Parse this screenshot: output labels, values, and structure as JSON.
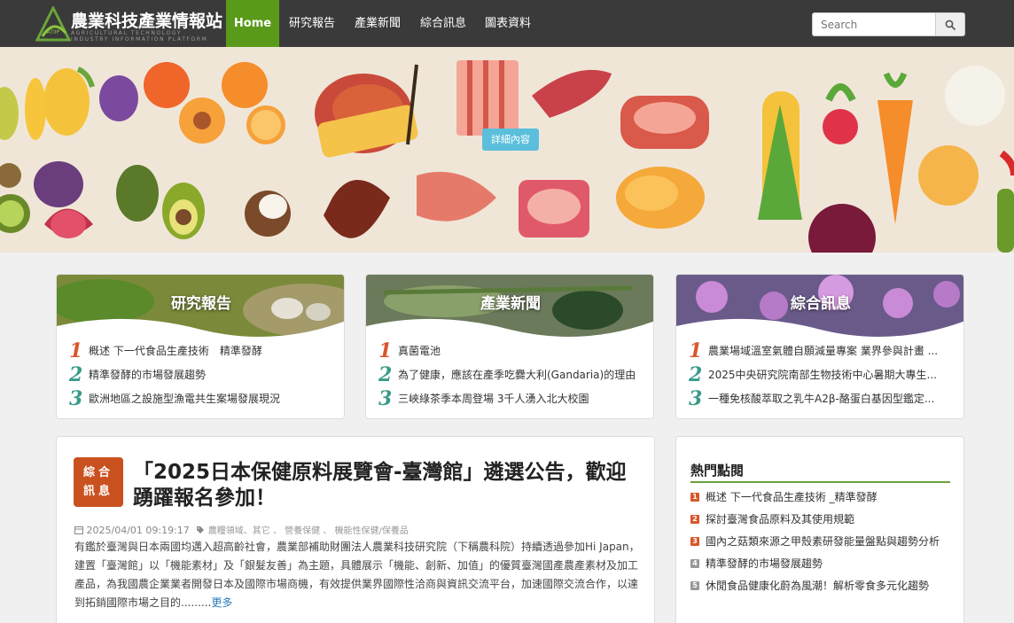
{
  "header": {
    "site_title": "農業科技產業情報站",
    "site_subtitle": "AGRICULTURAL TECHNOLOGY INDUSTRY INFORMATION PLATFORM",
    "logo_mark_text": "ATIIP",
    "nav": [
      {
        "label": "Home",
        "active": true
      },
      {
        "label": "研究報告"
      },
      {
        "label": "產業新聞"
      },
      {
        "label": "綜合訊息"
      },
      {
        "label": "圖表資料"
      }
    ],
    "search": {
      "placeholder": "Search",
      "icon": "search-icon"
    }
  },
  "banner": {
    "button_label": "詳細內容"
  },
  "cards": [
    {
      "title": "研究報告",
      "items": [
        {
          "rank": "1",
          "text": "概述 下一代食品生產技術　精準發酵"
        },
        {
          "rank": "2",
          "text": "精準發酵的市場發展趨勢"
        },
        {
          "rank": "3",
          "text": "歐洲地區之設施型漁電共生案場發展現況"
        }
      ]
    },
    {
      "title": "產業新聞",
      "items": [
        {
          "rank": "1",
          "text": "真菌電池"
        },
        {
          "rank": "2",
          "text": "為了健康，應該在產季吃爨大利(Gandaria)的理由"
        },
        {
          "rank": "3",
          "text": "三峽綠茶季本周登場 3千人湧入北大校園"
        }
      ]
    },
    {
      "title": "綜合訊息",
      "items": [
        {
          "rank": "1",
          "text": "農業場域溫室氣體自願減量專案 業界參與計畫 ..."
        },
        {
          "rank": "2",
          "text": "2025中央研究院南部生物技術中心暑期大專生..."
        },
        {
          "rank": "3",
          "text": "一種免核酸萃取之乳牛A2β-酪蛋白基因型鑑定..."
        }
      ]
    }
  ],
  "article": {
    "badge_line1": "綜合",
    "badge_line2": "訊息",
    "title": "「2025日本保健原料展覽會-臺灣館」遴選公告，歡迎踴躍報名參加！",
    "date": "2025/04/01 09:19:17",
    "tags": "農糧領域、其它 、 營養保健 、 機能性保健/保養品",
    "body": "有鑑於臺灣與日本兩國均邁入超高齡社會，農業部補助財團法人農業科技研究院（下稱農科院）持續透過參加Hi Japan，建置「臺灣館」以「機能素材」及「銀髮友善」為主題，具體展示「機能、創新、加值」的優質臺灣國產農產素材及加工產品，為我國農企業業者開發日本及國際市場商機，有效提供業界國際性洽商與資訊交流平台，加速國際交流合作，以達到拓銷國際市場之目的.........",
    "more_label": "更多"
  },
  "hot": {
    "title": "熱門點閱",
    "items": [
      {
        "num": "1",
        "text": "概述 下一代食品生產技術 _精準發酵"
      },
      {
        "num": "2",
        "text": "探討臺灣食品原料及其使用規範"
      },
      {
        "num": "3",
        "text": "國內之菇類來源之甲殼素研發能量盤點與趨勢分析"
      },
      {
        "num": "4",
        "text": "精準發酵的市場發展趨勢"
      },
      {
        "num": "5",
        "text": "休閒食品健康化蔚為風潮！解析零食多元化趨勢"
      }
    ]
  }
}
